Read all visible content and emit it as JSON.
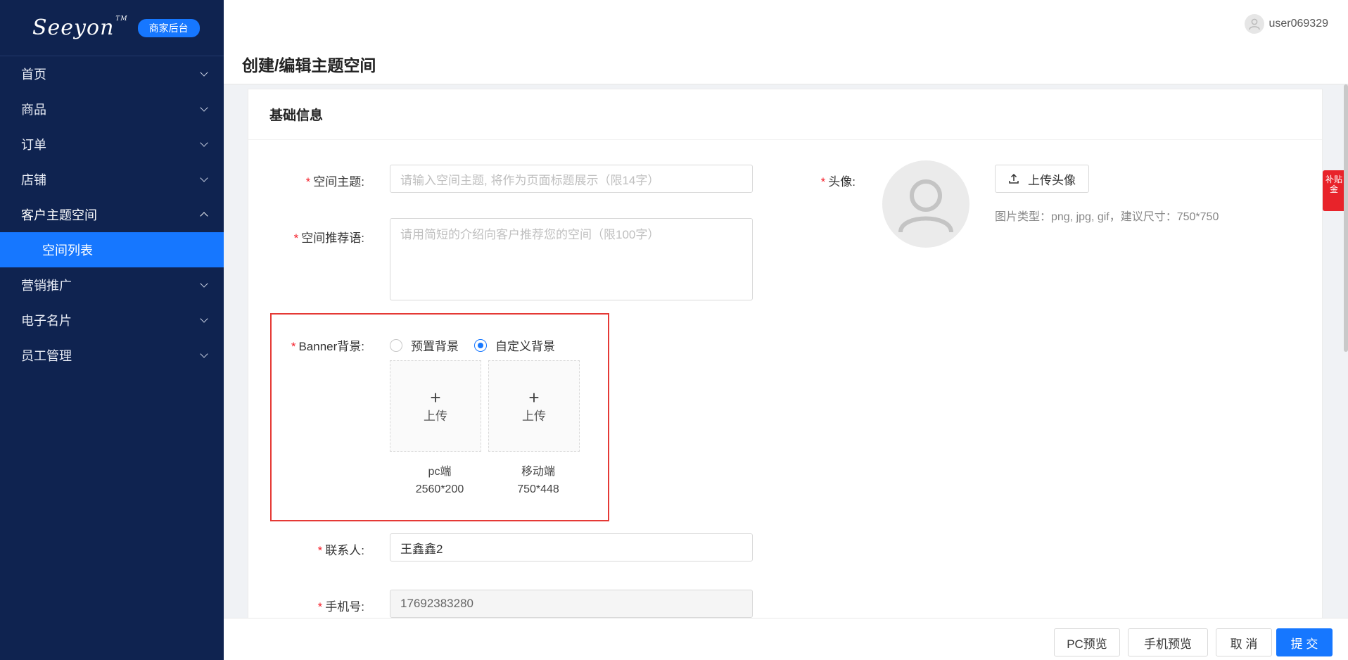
{
  "sidebar": {
    "logo": "Seeyon",
    "logo_tm": "TM",
    "badge": "商家后台",
    "menu": [
      {
        "label": "首页"
      },
      {
        "label": "商品"
      },
      {
        "label": "订单"
      },
      {
        "label": "店铺"
      },
      {
        "label": "客户主题空间"
      },
      {
        "label": "营销推广"
      },
      {
        "label": "电子名片"
      },
      {
        "label": "员工管理"
      }
    ],
    "submenu_active": "空间列表"
  },
  "header": {
    "title": "创建/编辑主题空间",
    "username": "user069329"
  },
  "card": {
    "title": "基础信息"
  },
  "form": {
    "theme": {
      "label": "空间主题:",
      "placeholder": "请输入空间主题, 将作为页面标题展示（限14字）"
    },
    "recommend": {
      "label": "空间推荐语:",
      "placeholder": "请用简短的介绍向客户推荐您的空间（限100字）"
    },
    "banner": {
      "label": "Banner背景:",
      "options": [
        "预置背景",
        "自定义背景"
      ],
      "selected": "自定义背景",
      "upload_label": "上传",
      "pc": {
        "name": "pc端",
        "size": "2560*200"
      },
      "mobile": {
        "name": "移动端",
        "size": "750*448"
      }
    },
    "contact": {
      "label": "联系人:",
      "value": "王鑫鑫2"
    },
    "phone": {
      "label": "手机号:",
      "value": "17692383280"
    },
    "avatar": {
      "label": "头像:",
      "upload_button": "上传头像",
      "hint": "图片类型：png, jpg, gif，建议尺寸：750*750"
    },
    "required_mark": "*"
  },
  "footer": {
    "pc_preview": "PC预览",
    "mobile_preview": "手机预览",
    "cancel": "取 消",
    "submit": "提 交"
  },
  "side_tag": "补贴金",
  "colors": {
    "sidebar_bg": "#0f2350",
    "accent": "#1677ff",
    "required": "#f5222d",
    "highlight_border": "#e53935"
  }
}
